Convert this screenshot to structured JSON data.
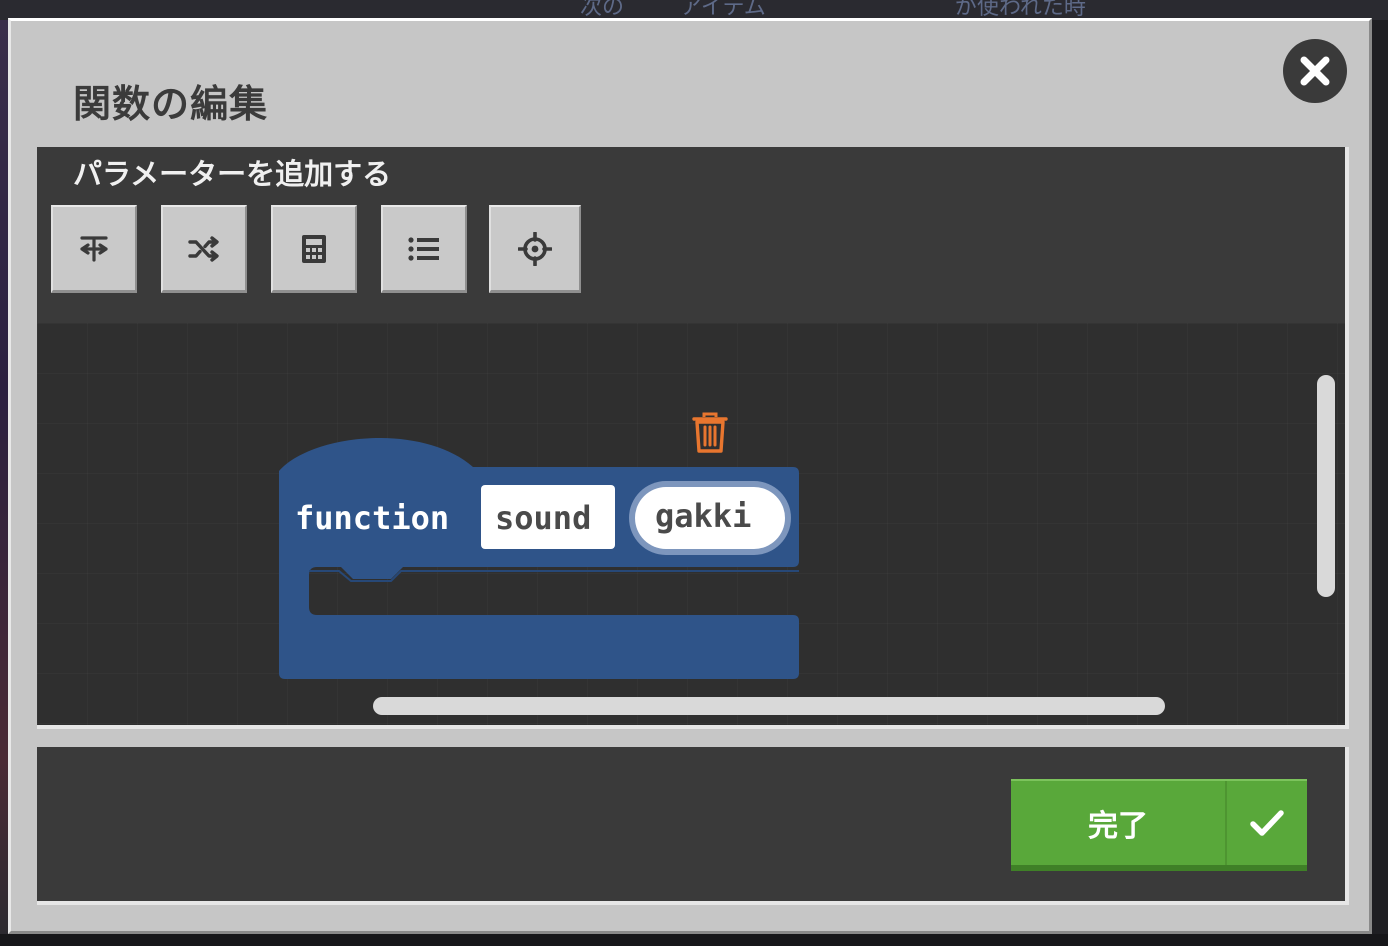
{
  "dialog": {
    "title": "関数の編集",
    "close_icon": "close-icon"
  },
  "toolbox": {
    "label": "パラメーターを追加する",
    "buttons": [
      {
        "icon": "text-type-icon"
      },
      {
        "icon": "shuffle-icon"
      },
      {
        "icon": "calculator-icon"
      },
      {
        "icon": "list-icon"
      },
      {
        "icon": "crosshair-icon"
      }
    ]
  },
  "block": {
    "keyword": "function",
    "name": "sound",
    "param": "gakki",
    "color": "#2f5489"
  },
  "trash_icon": "trash-icon",
  "footer": {
    "done_label": "完了",
    "done_color": "#59a83a",
    "done_icon": "check-icon"
  },
  "background_peek": {
    "text_left": "次の",
    "text_mid": "アイテム",
    "text_right": "が使われた時"
  }
}
